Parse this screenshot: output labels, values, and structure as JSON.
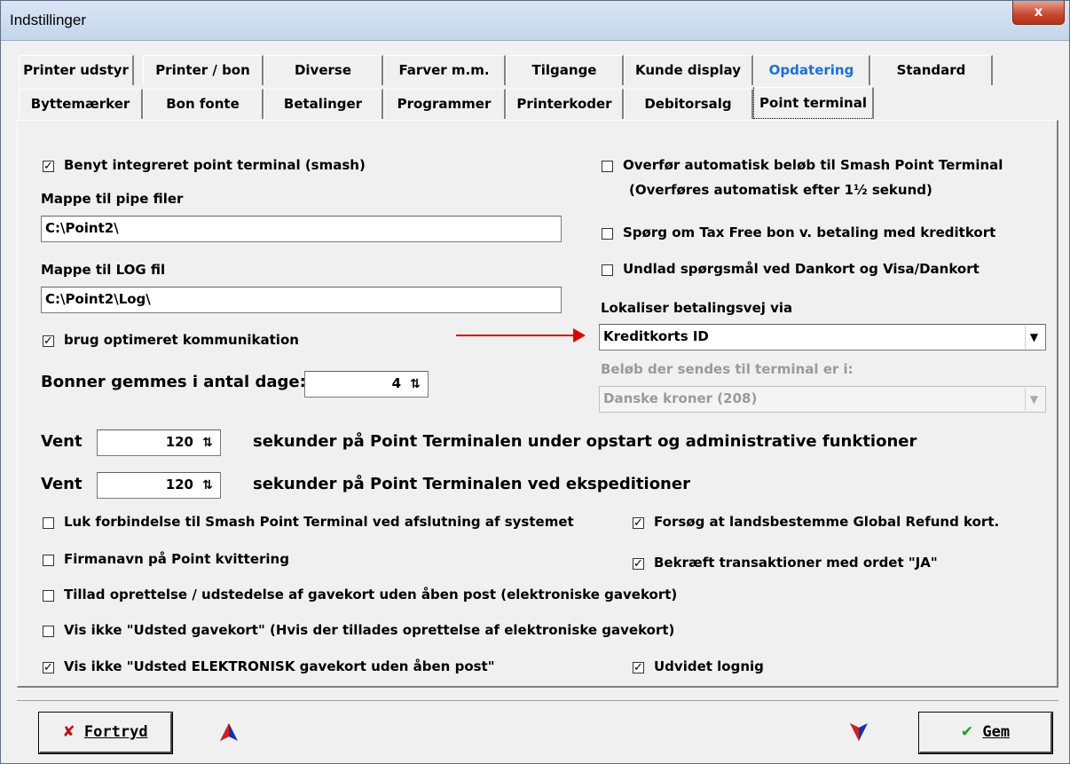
{
  "window": {
    "title": "Indstillinger",
    "close_label": "x"
  },
  "tabs": {
    "row1": [
      "Printer udstyr",
      "Printer / bon",
      "Diverse",
      "Farver m.m.",
      "Tilgange",
      "Kunde display",
      "Opdatering",
      "Standard"
    ],
    "row2": [
      "Byttemærker",
      "Bon fonte",
      "Betalinger",
      "Programmer",
      "Printerkoder",
      "Debitorsalg",
      "Point terminal"
    ],
    "active": "Point terminal",
    "highlighted": "Opdatering"
  },
  "left": {
    "use_integrated": {
      "label": "Benyt integreret point terminal (smash)",
      "checked": true
    },
    "pipe_folder_label": "Mappe til pipe filer",
    "pipe_folder_value": "C:\\Point2\\",
    "log_folder_label": "Mappe til LOG fil",
    "log_folder_value": "C:\\Point2\\Log\\",
    "optimized_comm": {
      "label": "brug optimeret kommunikation",
      "checked": true
    },
    "receipts_days_label": "Bonner gemmes i antal dage:",
    "receipts_days_value": "4"
  },
  "right": {
    "auto_transfer": {
      "label": "Overfør automatisk beløb til Smash Point Terminal",
      "checked": false
    },
    "auto_transfer_note": "(Overføres automatisk efter 1½ sekund)",
    "tax_free": {
      "label": "Spørg om Tax Free bon v. betaling med kreditkort",
      "checked": false
    },
    "skip_dankort": {
      "label": "Undlad spørgsmål ved Dankort og Visa/Dankort",
      "checked": false
    },
    "locate_label": "Lokaliser betalingsvej via",
    "locate_value": "Kreditkorts ID",
    "amount_label": "Beløb der sendes til terminal er i:",
    "amount_value": "Danske kroner (208)"
  },
  "wait": {
    "label": "Vent",
    "startup_value": "120",
    "startup_text": "sekunder på Point Terminalen under opstart og administrative funktioner",
    "exped_value": "120",
    "exped_text": "sekunder på Point Terminalen ved ekspeditioner"
  },
  "options": {
    "close_conn": {
      "label": "Luk forbindelse til Smash Point Terminal ved afslutning af systemet",
      "checked": false
    },
    "global_refund": {
      "label": "Forsøg at landsbestemme Global Refund kort.",
      "checked": true
    },
    "company_name": {
      "label": "Firmanavn på Point kvittering",
      "checked": false
    },
    "confirm_ja": {
      "label": "Bekræft transaktioner med ordet \"JA\"",
      "checked": true
    },
    "allow_giftcard": {
      "label": "Tillad oprettelse / udstedelse af gavekort uden åben post (elektroniske gavekort)",
      "checked": false
    },
    "hide_issue": {
      "label": "Vis ikke \"Udsted gavekort\" (Hvis der tillades oprettelse af elektroniske gavekort)",
      "checked": false
    },
    "hide_electronic": {
      "label": "Vis ikke \"Udsted ELEKTRONISK gavekort uden åben post\"",
      "checked": true
    },
    "extended_log": {
      "label": "Udvidet lognig",
      "checked": true
    }
  },
  "buttons": {
    "cancel": "Fortryd",
    "save": "Gem"
  },
  "colors": {
    "accent_blue": "#1e6fd6",
    "arrow_red": "#e00000",
    "cancel_x": "#c01010",
    "save_check": "#1aa01a"
  }
}
